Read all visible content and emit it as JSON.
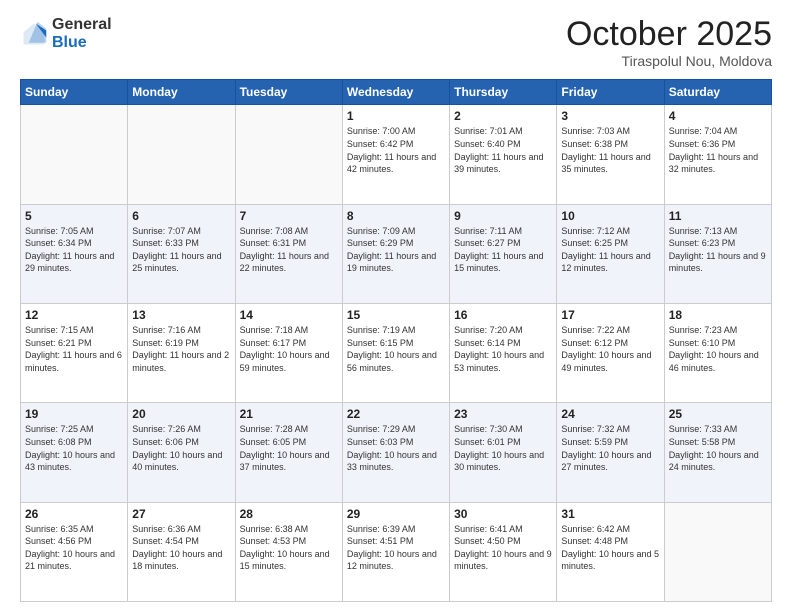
{
  "header": {
    "logo_general": "General",
    "logo_blue": "Blue",
    "title": "October 2025",
    "location": "Tiraspolul Nou, Moldova"
  },
  "days_of_week": [
    "Sunday",
    "Monday",
    "Tuesday",
    "Wednesday",
    "Thursday",
    "Friday",
    "Saturday"
  ],
  "weeks": [
    {
      "stripe": false,
      "days": [
        {
          "day": "",
          "info": ""
        },
        {
          "day": "",
          "info": ""
        },
        {
          "day": "",
          "info": ""
        },
        {
          "day": "1",
          "info": "Sunrise: 7:00 AM\nSunset: 6:42 PM\nDaylight: 11 hours\nand 42 minutes."
        },
        {
          "day": "2",
          "info": "Sunrise: 7:01 AM\nSunset: 6:40 PM\nDaylight: 11 hours\nand 39 minutes."
        },
        {
          "day": "3",
          "info": "Sunrise: 7:03 AM\nSunset: 6:38 PM\nDaylight: 11 hours\nand 35 minutes."
        },
        {
          "day": "4",
          "info": "Sunrise: 7:04 AM\nSunset: 6:36 PM\nDaylight: 11 hours\nand 32 minutes."
        }
      ]
    },
    {
      "stripe": true,
      "days": [
        {
          "day": "5",
          "info": "Sunrise: 7:05 AM\nSunset: 6:34 PM\nDaylight: 11 hours\nand 29 minutes."
        },
        {
          "day": "6",
          "info": "Sunrise: 7:07 AM\nSunset: 6:33 PM\nDaylight: 11 hours\nand 25 minutes."
        },
        {
          "day": "7",
          "info": "Sunrise: 7:08 AM\nSunset: 6:31 PM\nDaylight: 11 hours\nand 22 minutes."
        },
        {
          "day": "8",
          "info": "Sunrise: 7:09 AM\nSunset: 6:29 PM\nDaylight: 11 hours\nand 19 minutes."
        },
        {
          "day": "9",
          "info": "Sunrise: 7:11 AM\nSunset: 6:27 PM\nDaylight: 11 hours\nand 15 minutes."
        },
        {
          "day": "10",
          "info": "Sunrise: 7:12 AM\nSunset: 6:25 PM\nDaylight: 11 hours\nand 12 minutes."
        },
        {
          "day": "11",
          "info": "Sunrise: 7:13 AM\nSunset: 6:23 PM\nDaylight: 11 hours\nand 9 minutes."
        }
      ]
    },
    {
      "stripe": false,
      "days": [
        {
          "day": "12",
          "info": "Sunrise: 7:15 AM\nSunset: 6:21 PM\nDaylight: 11 hours\nand 6 minutes."
        },
        {
          "day": "13",
          "info": "Sunrise: 7:16 AM\nSunset: 6:19 PM\nDaylight: 11 hours\nand 2 minutes."
        },
        {
          "day": "14",
          "info": "Sunrise: 7:18 AM\nSunset: 6:17 PM\nDaylight: 10 hours\nand 59 minutes."
        },
        {
          "day": "15",
          "info": "Sunrise: 7:19 AM\nSunset: 6:15 PM\nDaylight: 10 hours\nand 56 minutes."
        },
        {
          "day": "16",
          "info": "Sunrise: 7:20 AM\nSunset: 6:14 PM\nDaylight: 10 hours\nand 53 minutes."
        },
        {
          "day": "17",
          "info": "Sunrise: 7:22 AM\nSunset: 6:12 PM\nDaylight: 10 hours\nand 49 minutes."
        },
        {
          "day": "18",
          "info": "Sunrise: 7:23 AM\nSunset: 6:10 PM\nDaylight: 10 hours\nand 46 minutes."
        }
      ]
    },
    {
      "stripe": true,
      "days": [
        {
          "day": "19",
          "info": "Sunrise: 7:25 AM\nSunset: 6:08 PM\nDaylight: 10 hours\nand 43 minutes."
        },
        {
          "day": "20",
          "info": "Sunrise: 7:26 AM\nSunset: 6:06 PM\nDaylight: 10 hours\nand 40 minutes."
        },
        {
          "day": "21",
          "info": "Sunrise: 7:28 AM\nSunset: 6:05 PM\nDaylight: 10 hours\nand 37 minutes."
        },
        {
          "day": "22",
          "info": "Sunrise: 7:29 AM\nSunset: 6:03 PM\nDaylight: 10 hours\nand 33 minutes."
        },
        {
          "day": "23",
          "info": "Sunrise: 7:30 AM\nSunset: 6:01 PM\nDaylight: 10 hours\nand 30 minutes."
        },
        {
          "day": "24",
          "info": "Sunrise: 7:32 AM\nSunset: 5:59 PM\nDaylight: 10 hours\nand 27 minutes."
        },
        {
          "day": "25",
          "info": "Sunrise: 7:33 AM\nSunset: 5:58 PM\nDaylight: 10 hours\nand 24 minutes."
        }
      ]
    },
    {
      "stripe": false,
      "days": [
        {
          "day": "26",
          "info": "Sunrise: 6:35 AM\nSunset: 4:56 PM\nDaylight: 10 hours\nand 21 minutes."
        },
        {
          "day": "27",
          "info": "Sunrise: 6:36 AM\nSunset: 4:54 PM\nDaylight: 10 hours\nand 18 minutes."
        },
        {
          "day": "28",
          "info": "Sunrise: 6:38 AM\nSunset: 4:53 PM\nDaylight: 10 hours\nand 15 minutes."
        },
        {
          "day": "29",
          "info": "Sunrise: 6:39 AM\nSunset: 4:51 PM\nDaylight: 10 hours\nand 12 minutes."
        },
        {
          "day": "30",
          "info": "Sunrise: 6:41 AM\nSunset: 4:50 PM\nDaylight: 10 hours\nand 9 minutes."
        },
        {
          "day": "31",
          "info": "Sunrise: 6:42 AM\nSunset: 4:48 PM\nDaylight: 10 hours\nand 5 minutes."
        },
        {
          "day": "",
          "info": ""
        }
      ]
    }
  ]
}
